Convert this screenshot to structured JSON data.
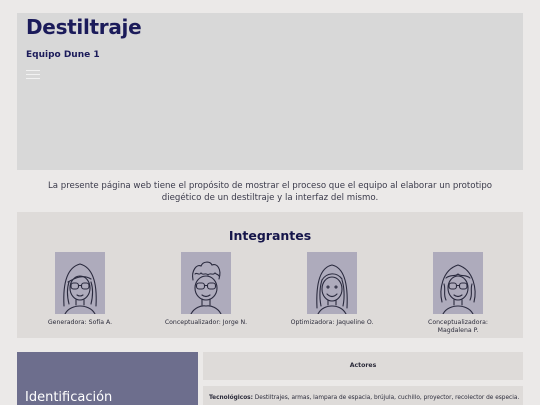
{
  "header": {
    "title": "Destiltraje",
    "team": "Equipo Dune 1",
    "menu_icon": "hamburger-menu-icon"
  },
  "intro": {
    "line1": "La presente página web tiene el propósito de mostrar el proceso que el equipo al elaborar un prototipo",
    "line2": "diegético de un destiltraje y la interfaz del mismo."
  },
  "members_section": {
    "title": "Integrantes",
    "members": [
      {
        "role_line1": "Generadora: Sofía A.",
        "role_line2": ""
      },
      {
        "role_line1": "Conceptualizador: Jorge N.",
        "role_line2": ""
      },
      {
        "role_line1": "Optimizadora: Jaqueline O.",
        "role_line2": ""
      },
      {
        "role_line1": "Conceptualizadora:",
        "role_line2": "Magdalena P."
      }
    ]
  },
  "identification": {
    "title": "Identificación"
  },
  "actors": {
    "title": "Actores"
  },
  "tech": {
    "label": "Tecnológicos:",
    "text": " Destiltrajes, armas, lampara de espacia, brújula, cuchillo, proyector, recolector de especia."
  },
  "colors": {
    "background": "#ebe9e8",
    "hero": "#d8d8d8",
    "panel": "#dedbd9",
    "accent": "#6d6e8d",
    "title": "#1b1b5a",
    "avatar_bg": "#aeabbc"
  }
}
